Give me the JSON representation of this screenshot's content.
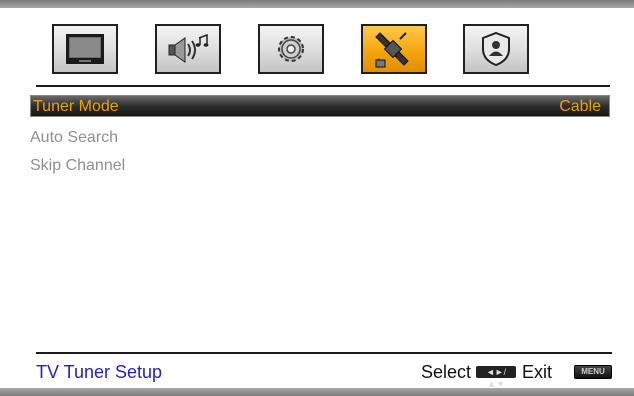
{
  "tabs": [
    {
      "icon": "tv-picture-icon"
    },
    {
      "icon": "speaker-music-icon"
    },
    {
      "icon": "gear-icon"
    },
    {
      "icon": "satellite-icon"
    },
    {
      "icon": "lock-shield-icon"
    }
  ],
  "active_tab_index": 3,
  "menu": {
    "items": [
      {
        "label": "Tuner Mode",
        "value": "Cable",
        "selected": true
      },
      {
        "label": "Auto Search"
      },
      {
        "label": "Skip Channel"
      }
    ]
  },
  "footer": {
    "title": "TV Tuner Setup",
    "select_label": "Select",
    "select_key": "◄►/▲▼",
    "exit_label": "Exit",
    "menu_key": "MENU"
  },
  "colors": {
    "selected_text": "#f0a000",
    "item_text": "#8f8f8f",
    "footer_title": "#2323b8",
    "active_tab": "#f4a60e"
  }
}
